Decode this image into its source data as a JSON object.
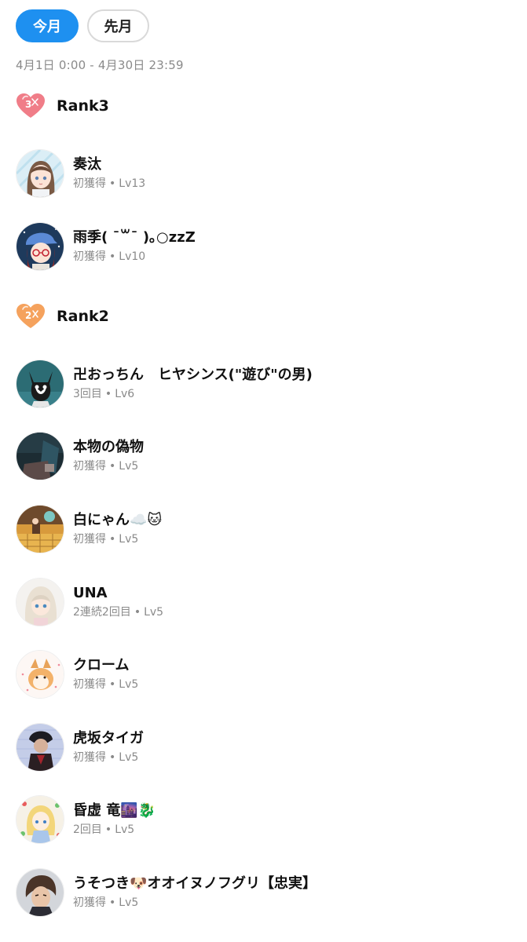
{
  "tabs": [
    {
      "label": "今月",
      "active": true
    },
    {
      "label": "先月",
      "active": false
    }
  ],
  "period": "4月1日 0:00 - 4月30日 23:59",
  "colors": {
    "accent": "#1e90f0",
    "rank3_heart": "#f07d88",
    "rank2_heart": "#f5a25d",
    "meta_text": "#8a8a8a"
  },
  "ranks": [
    {
      "title": "Rank3",
      "badge_number": "3",
      "icon": "heart-rank3-icon",
      "members": [
        {
          "name": "奏汰",
          "status": "初獲得",
          "level": "Lv13"
        },
        {
          "name": "雨季( ˉ꒳ˉ )｡○zzZ",
          "status": "初獲得",
          "level": "Lv10"
        }
      ]
    },
    {
      "title": "Rank2",
      "badge_number": "2",
      "icon": "heart-rank2-icon",
      "members": [
        {
          "name": "卍おっちん　ヒヤシンス(\"遊び\"の男)",
          "status": "3回目",
          "level": "Lv6"
        },
        {
          "name": "本物の偽物",
          "status": "初獲得",
          "level": "Lv5"
        },
        {
          "name": "白にゃん☁️🐱",
          "status": "初獲得",
          "level": "Lv5"
        },
        {
          "name": "UNA",
          "status": "2連続2回目",
          "level": "Lv5"
        },
        {
          "name": "クローム",
          "status": "初獲得",
          "level": "Lv5"
        },
        {
          "name": "虎坂タイガ",
          "status": "初獲得",
          "level": "Lv5"
        },
        {
          "name": "昏虚 竜🌆🐉",
          "status": "2回目",
          "level": "Lv5"
        },
        {
          "name": "うそつき🐶オオイヌノフグリ【忠実】",
          "status": "初獲得",
          "level": "Lv5"
        }
      ]
    }
  ],
  "separator": "•"
}
